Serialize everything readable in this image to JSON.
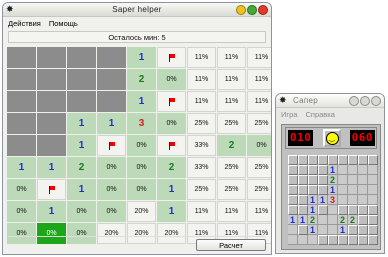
{
  "helper": {
    "title": "Saper helper",
    "menu": [
      "Действия",
      "Помощь"
    ],
    "status": "Осталось мин: 5",
    "button": "Расчет",
    "grid": [
      [
        "h",
        "h",
        "h",
        "h",
        "1",
        "F",
        "11%",
        "11%",
        "11%"
      ],
      [
        "h",
        "h",
        "h",
        "h",
        "2",
        "0%",
        "11%",
        "11%",
        "11%"
      ],
      [
        "h",
        "h",
        "h",
        "h",
        "1",
        "F",
        "11%",
        "11%",
        "11%"
      ],
      [
        "h",
        "h",
        "1",
        "1",
        "3",
        "0%",
        "25%",
        "25%",
        "25%"
      ],
      [
        "h",
        "h",
        "1",
        "F",
        "0%",
        "F",
        "33%",
        "2",
        "0%"
      ],
      [
        "1",
        "1",
        "2",
        "0%",
        "0%",
        "2",
        "33%",
        "25%",
        "25%"
      ],
      [
        "0%",
        "F",
        "1",
        "0%",
        "0%",
        "1",
        "25%",
        "25%",
        "25%"
      ],
      [
        "0%",
        "1",
        "0%",
        "0%",
        "20%",
        "1",
        "11%",
        "11%",
        "11%"
      ],
      [
        "0%",
        "0%",
        "0%",
        "20%",
        "20%",
        "20%",
        "11%",
        "11%",
        "11%"
      ]
    ],
    "number_colors": {
      "1": "#1a2fd0",
      "2": "#1b7a20",
      "3": "#d42020"
    },
    "green_cell": "#1ca71a"
  },
  "minesweeper": {
    "title": "Сапер",
    "menu": [
      "Игра",
      "Справка"
    ],
    "mines_counter": "010",
    "timer": "060",
    "face": "smiley-icon",
    "grid": [
      [
        "u",
        "u",
        "u",
        "u",
        "u",
        "u",
        "u",
        "u",
        "u"
      ],
      [
        "u",
        "u",
        "u",
        "u",
        "1",
        "o",
        "o",
        "o",
        "o"
      ],
      [
        "u",
        "u",
        "u",
        "u",
        "2",
        "o",
        "o",
        "o",
        "o"
      ],
      [
        "u",
        "u",
        "u",
        "u",
        "1",
        "o",
        "o",
        "o",
        "o"
      ],
      [
        "u",
        "u",
        "1",
        "1",
        "3",
        "o",
        "o",
        "o",
        "o"
      ],
      [
        "u",
        "u",
        "1",
        "u",
        "o",
        "u",
        "u",
        "u",
        "u"
      ],
      [
        "1",
        "1",
        "2",
        "o",
        "o",
        "2",
        "2",
        "u",
        "u"
      ],
      [
        "o",
        "u",
        "1",
        "o",
        "o",
        "1",
        "u",
        "u",
        "u"
      ],
      [
        "o",
        "o",
        "o",
        "u",
        "u",
        "u",
        "u",
        "u",
        "u"
      ]
    ]
  }
}
